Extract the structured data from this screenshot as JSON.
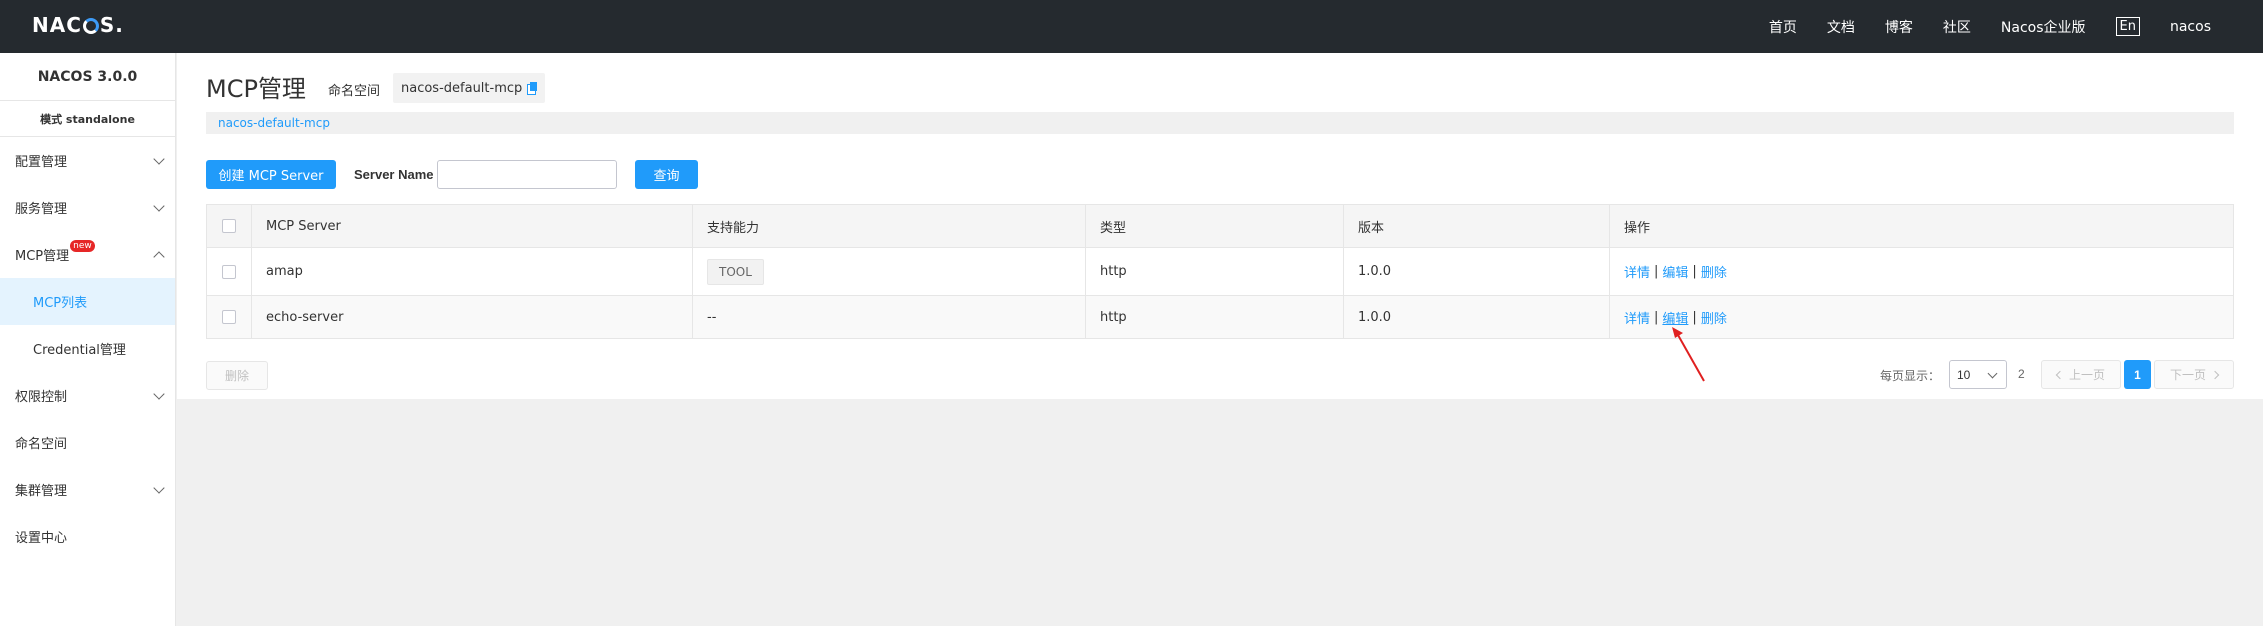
{
  "topbar": {
    "logo": "NACOS.",
    "nav": [
      "首页",
      "文档",
      "博客",
      "社区",
      "Nacos企业版"
    ],
    "lang": "En",
    "user": "nacos"
  },
  "sidebar": {
    "version": "NACOS 3.0.0",
    "mode": "模式 standalone",
    "items": [
      {
        "label": "配置管理"
      },
      {
        "label": "服务管理"
      },
      {
        "label": "MCP管理",
        "badge": "new"
      },
      {
        "label": "MCP列表",
        "active": true
      },
      {
        "label": "Credential管理"
      },
      {
        "label": "权限控制"
      },
      {
        "label": "命名空间"
      },
      {
        "label": "集群管理"
      },
      {
        "label": "设置中心"
      }
    ]
  },
  "main": {
    "title": "MCP管理",
    "namespace_label": "命名空间",
    "namespace_value": "nacos-default-mcp",
    "namespace_bar": "nacos-default-mcp",
    "create_button": "创建 MCP Server",
    "search_label": "Server Name",
    "search_value": "",
    "query_button": "查询",
    "table": {
      "headers": [
        "MCP Server",
        "支持能力",
        "类型",
        "版本",
        "操作"
      ],
      "rows": [
        {
          "name": "amap",
          "capability": "TOOL",
          "type": "http",
          "version": "1.0.0"
        },
        {
          "name": "echo-server",
          "capability": "--",
          "type": "http",
          "version": "1.0.0"
        }
      ],
      "ops": {
        "detail": "详情",
        "edit": "编辑",
        "delete": "删除",
        "sep": "|"
      }
    },
    "delete_button": "删除",
    "pagination": {
      "per_page_label": "每页显示：",
      "page_size": "10",
      "total": "2",
      "prev": "上一页",
      "current": "1",
      "next": "下一页"
    }
  },
  "colors": {
    "accent": "#209bfa",
    "topbar": "#252a2f",
    "annotation_arrow": "#e02020"
  }
}
